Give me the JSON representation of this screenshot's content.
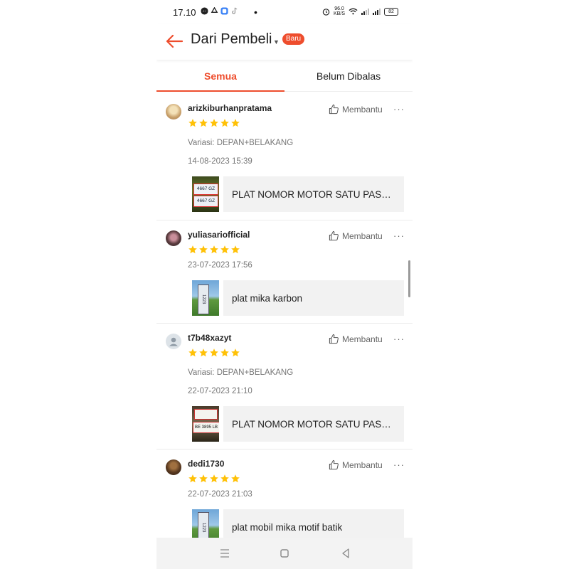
{
  "status_bar": {
    "time": "17.10",
    "net_speed_value": "96.0",
    "net_speed_unit": "KB/S",
    "battery": "82"
  },
  "header": {
    "title": "Dari Pembeli",
    "badge": "Baru"
  },
  "tabs": [
    {
      "label": "Semua",
      "active": true
    },
    {
      "label": "Belum Dibalas",
      "active": false
    }
  ],
  "helpful_label": "Membantu",
  "more_label": "···",
  "reviews": [
    {
      "username": "arizkiburhanpratama",
      "rating": 5,
      "variation": "Variasi: DEPAN+BELAKANG",
      "date": "14-08-2023 15:39",
      "product": "PLAT NOMOR MOTOR SATU PASANG"
    },
    {
      "username": "yuliasariofficial",
      "rating": 5,
      "variation": "",
      "date": "23-07-2023 17:56",
      "product": "plat mika karbon"
    },
    {
      "username": "t7b48xazyt",
      "rating": 5,
      "variation": "Variasi: DEPAN+BELAKANG",
      "date": "22-07-2023 21:10",
      "product": "PLAT NOMOR MOTOR SATU PASANG"
    },
    {
      "username": "dedi1730",
      "rating": 5,
      "variation": "",
      "date": "22-07-2023 21:03",
      "product": "plat mobil mika motif batik"
    }
  ],
  "thumb_text": {
    "plate_a": "4667 GZ",
    "plate_b": "1223",
    "plate_c": "BE 3895 LB"
  },
  "colors": {
    "accent": "#ee4d2d",
    "star": "#ffc107"
  }
}
